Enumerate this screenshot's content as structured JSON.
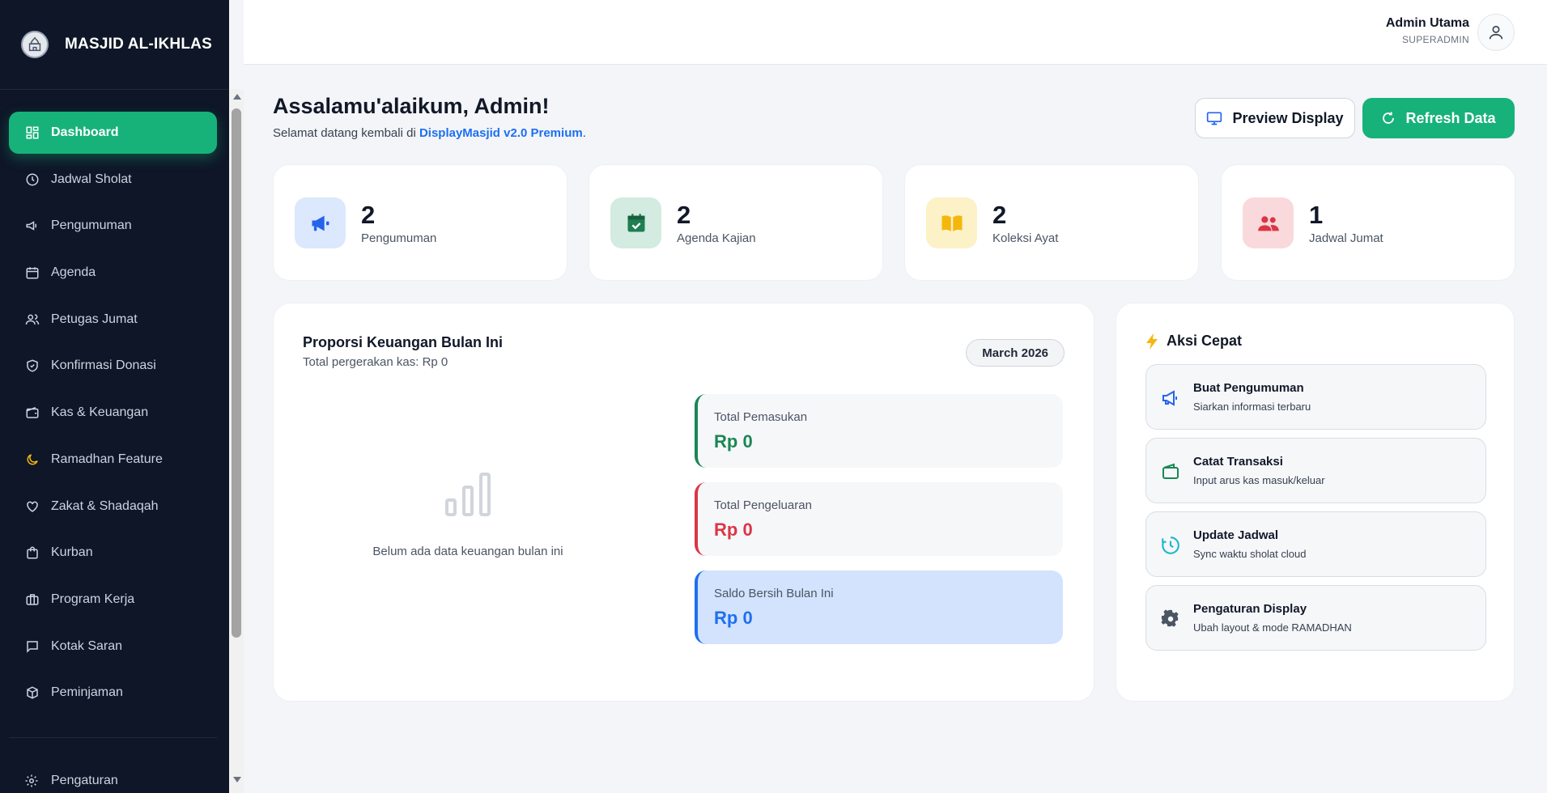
{
  "brand": {
    "name": "MASJID AL-IKHLAS"
  },
  "sidebar": {
    "items": [
      {
        "label": "Dashboard",
        "icon": "grid-icon",
        "active": true
      },
      {
        "label": "Jadwal Sholat",
        "icon": "clock-icon"
      },
      {
        "label": "Pengumuman",
        "icon": "megaphone-icon"
      },
      {
        "label": "Agenda",
        "icon": "calendar-icon"
      },
      {
        "label": "Petugas Jumat",
        "icon": "users-icon"
      },
      {
        "label": "Konfirmasi Donasi",
        "icon": "shield-check-icon"
      },
      {
        "label": "Kas & Keuangan",
        "icon": "wallet-icon"
      },
      {
        "label": "Ramadhan Feature",
        "icon": "moon-icon"
      },
      {
        "label": "Zakat & Shadaqah",
        "icon": "heart-icon"
      },
      {
        "label": "Kurban",
        "icon": "shopping-bag-icon"
      },
      {
        "label": "Program Kerja",
        "icon": "briefcase-icon"
      },
      {
        "label": "Kotak Saran",
        "icon": "message-square-icon"
      },
      {
        "label": "Peminjaman",
        "icon": "package-icon"
      }
    ],
    "settings": {
      "label": "Pengaturan",
      "icon": "gear-icon"
    }
  },
  "topbar": {
    "user_name": "Admin Utama",
    "user_role": "SUPERADMIN"
  },
  "header": {
    "greeting": "Assalamu'alaikum, Admin!",
    "subtitle_prefix": "Selamat datang kembali di ",
    "subtitle_brand": "DisplayMasjid v2.0 Premium",
    "subtitle_suffix": ".",
    "preview_label": "Preview Display",
    "refresh_label": "Refresh Data"
  },
  "stats": [
    {
      "value": "2",
      "label": "Pengumuman",
      "icon": "megaphone-icon",
      "bg": "#dbe8fd",
      "fg": "#2563eb"
    },
    {
      "value": "2",
      "label": "Agenda Kajian",
      "icon": "calendar-check-icon",
      "bg": "#d3ebe0",
      "fg": "#1e7f53"
    },
    {
      "value": "2",
      "label": "Koleksi Ayat",
      "icon": "book-open-icon",
      "bg": "#fdf1c7",
      "fg": "#f5b70e"
    },
    {
      "value": "1",
      "label": "Jadwal Jumat",
      "icon": "users-icon",
      "bg": "#f9d9dc",
      "fg": "#dc3545"
    }
  ],
  "finance": {
    "title": "Proporsi Keuangan Bulan Ini",
    "subtitle": "Total pergerakan kas: Rp 0",
    "month": "March 2026",
    "empty_text": "Belum ada data keuangan bulan ini",
    "cards": [
      {
        "label": "Total Pemasukan",
        "value": "Rp 0",
        "color": "#198754",
        "bg": "#f6f7f9"
      },
      {
        "label": "Total Pengeluaran",
        "value": "Rp 0",
        "color": "#dc3545",
        "bg": "#f6f7f9"
      },
      {
        "label": "Saldo Bersih Bulan Ini",
        "value": "Rp 0",
        "color": "#1d6ff2",
        "bg": "#d3e3fd"
      }
    ]
  },
  "quick_actions": {
    "title": "Aksi Cepat",
    "items": [
      {
        "title": "Buat Pengumuman",
        "subtitle": "Siarkan informasi terbaru",
        "icon": "megaphone-icon",
        "color": "#2563eb"
      },
      {
        "title": "Catat Transaksi",
        "subtitle": "Input arus kas masuk/keluar",
        "icon": "wallet-icon",
        "color": "#198754"
      },
      {
        "title": "Update Jadwal",
        "subtitle": "Sync waktu sholat cloud",
        "icon": "clock-icon",
        "color": "#22b8cf"
      },
      {
        "title": "Pengaturan Display",
        "subtitle": "Ubah layout & mode RAMADHAN",
        "icon": "gear-icon",
        "color": "#4b5563"
      }
    ]
  }
}
